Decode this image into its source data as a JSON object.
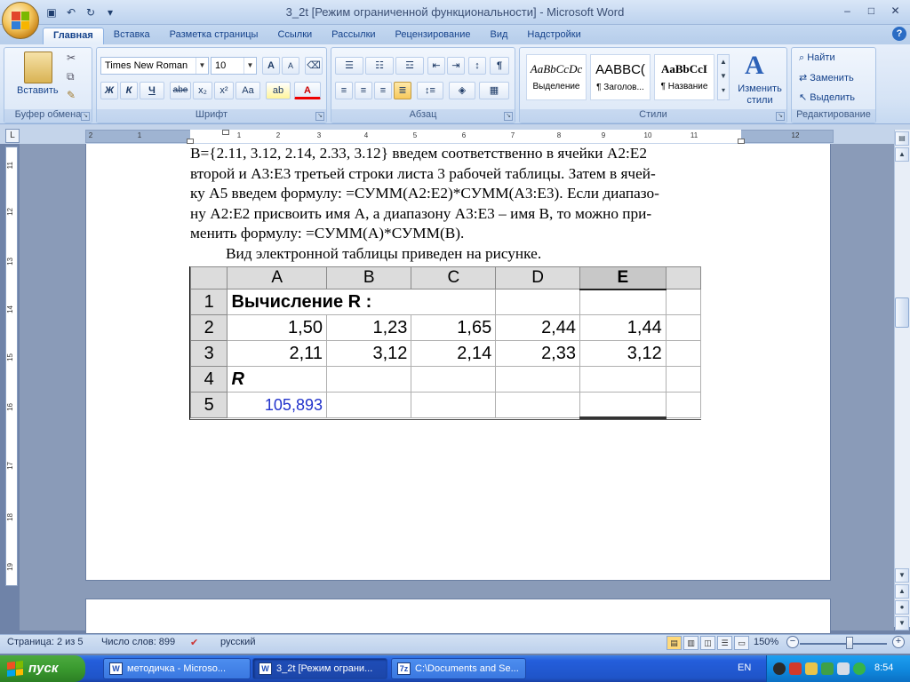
{
  "window": {
    "title": "3_2t [Режим ограниченной функциональности] - Microsoft Word",
    "controls": [
      "–",
      "□",
      "✕"
    ]
  },
  "qat": [
    "save-icon",
    "undo-icon",
    "redo-icon",
    "customize-icon"
  ],
  "tabs": [
    "Главная",
    "Вставка",
    "Разметка страницы",
    "Ссылки",
    "Рассылки",
    "Рецензирование",
    "Вид",
    "Надстройки"
  ],
  "ribbon": {
    "clipboard": {
      "label": "Буфер обмена",
      "paste": "Вставить"
    },
    "font": {
      "label": "Шрифт",
      "family": "Times New Roman",
      "size": "10",
      "bold": "Ж",
      "italic": "К",
      "underline": "Ч",
      "strike": "abe",
      "sub": "x₂",
      "sup": "x²",
      "case": "Aa",
      "grow": "A",
      "shrink": "A"
    },
    "paragraph": {
      "label": "Абзац",
      "pilcrow": "¶"
    },
    "styles": {
      "label": "Стили",
      "items": [
        {
          "sample": "AaBbCcDc",
          "name": "Выделение"
        },
        {
          "sample": "AABBC(",
          "name": "¶ Заголов..."
        },
        {
          "sample": "AaBbCcI",
          "name": "¶ Название"
        }
      ],
      "change": "Изменить стили"
    },
    "editing": {
      "label": "Редактирование",
      "find": "Найти",
      "replace": "Заменить",
      "select": "Выделить"
    }
  },
  "ruler": {
    "h_ticks": [
      "2",
      "1",
      "1",
      "2",
      "3",
      "4",
      "5",
      "6",
      "7",
      "8",
      "9",
      "10",
      "11",
      "12"
    ],
    "v_ticks": [
      "11",
      "12",
      "13",
      "14",
      "15",
      "16",
      "17",
      "18",
      "19"
    ]
  },
  "document": {
    "lines": [
      "B={2.11, 3.12, 2.14, 2.33, 3.12}  введем соответственно в ячейки A2:E2",
      "второй и A3:E3 третьей строки листа 3 рабочей таблицы. Затем в ячей-",
      "ку A5 введем формулу: =СУММ(A2:E2)*СУММ(A3:E3). Если диапазо-",
      "ну A2:E2 присвоить имя A, а диапазону A3:E3 – имя B, то можно при-",
      "менить формулу:  =СУММ(A)*СУММ(B)."
    ],
    "caption": "Вид электронной таблицы приведен на рисунке."
  },
  "sheet": {
    "columns": [
      "A",
      "B",
      "C",
      "D",
      "E"
    ],
    "rows": [
      {
        "num": "1",
        "cells": [
          "Вычисление R :",
          "",
          "",
          "",
          ""
        ]
      },
      {
        "num": "2",
        "cells": [
          "1,50",
          "1,23",
          "1,65",
          "2,44",
          "1,44"
        ]
      },
      {
        "num": "3",
        "cells": [
          "2,11",
          "3,12",
          "2,14",
          "2,33",
          "3,12"
        ]
      },
      {
        "num": "4",
        "cells": [
          "R",
          "",
          "",
          "",
          ""
        ]
      },
      {
        "num": "5",
        "cells": [
          "105,893",
          "",
          "",
          "",
          ""
        ]
      }
    ]
  },
  "status": {
    "page": "Страница: 2 из 5",
    "words": "Число слов: 899",
    "language": "русский",
    "zoom": "150%"
  },
  "taskbar": {
    "start": "пуск",
    "tasks": [
      "методичка - Microso...",
      "3_2t [Режим ограни...",
      "C:\\Documents and Se..."
    ],
    "lang": "EN",
    "clock": "8:54"
  }
}
